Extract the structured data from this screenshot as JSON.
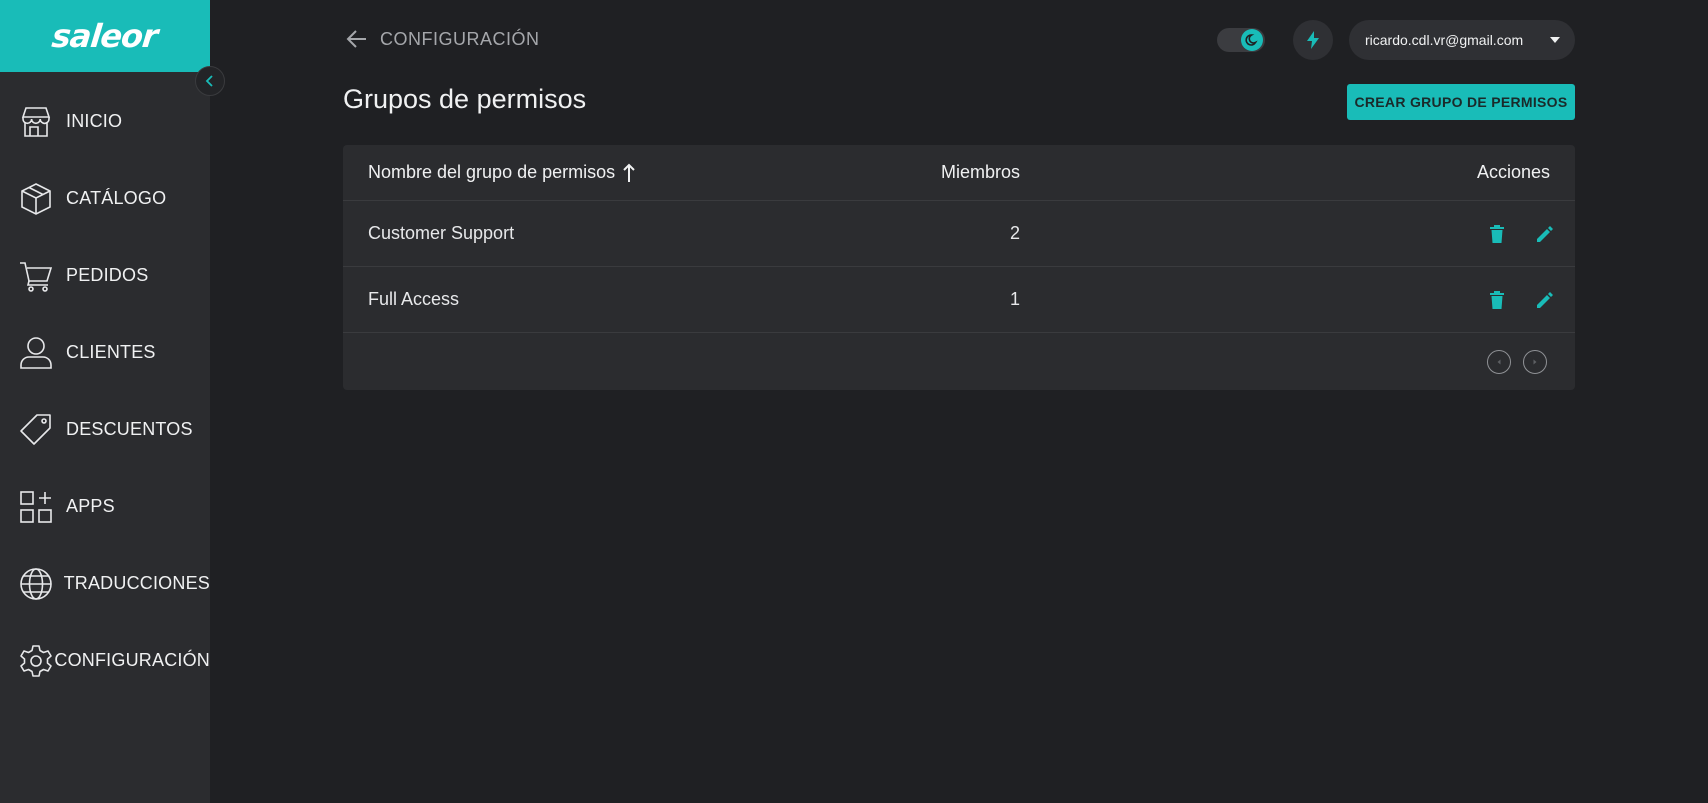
{
  "brand": {
    "logo_text": "saleor",
    "accent": "#19bcb8"
  },
  "sidebar": {
    "collapse_icon": "chevron-left-icon",
    "items": [
      {
        "label": "INICIO",
        "icon": "store-icon"
      },
      {
        "label": "CATÁLOGO",
        "icon": "box-icon"
      },
      {
        "label": "PEDIDOS",
        "icon": "cart-icon"
      },
      {
        "label": "CLIENTES",
        "icon": "user-icon"
      },
      {
        "label": "DESCUENTOS",
        "icon": "tag-icon"
      },
      {
        "label": "APPS",
        "icon": "apps-icon"
      },
      {
        "label": "TRADUCCIONES",
        "icon": "globe-icon"
      },
      {
        "label": "CONFIGURACIÓN",
        "icon": "gear-icon"
      }
    ]
  },
  "topbar": {
    "back_label": "CONFIGURACIÓN",
    "user_email": "ricardo.cdl.vr@gmail.com"
  },
  "page": {
    "title": "Grupos de permisos",
    "create_button": "CREAR GRUPO DE PERMISOS"
  },
  "table": {
    "columns": {
      "name": "Nombre del grupo de permisos",
      "members": "Miembros",
      "actions": "Acciones"
    },
    "rows": [
      {
        "name": "Customer Support",
        "members": "2"
      },
      {
        "name": "Full Access",
        "members": "1"
      }
    ]
  }
}
